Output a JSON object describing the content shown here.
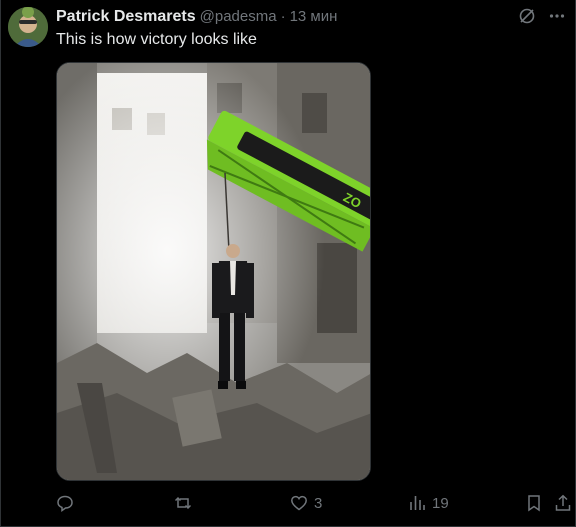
{
  "post": {
    "author_name": "Patrick Desmarets",
    "author_handle": "@padesma",
    "separator": "·",
    "time_ago": "13 мин",
    "text": "This is how victory looks like"
  },
  "media": {
    "crane_label": "ZO"
  },
  "actions": {
    "reply_count": "",
    "repost_count": "",
    "like_count": "3",
    "views_count": "19"
  },
  "icons": {
    "grok": "grok-icon",
    "more": "more-icon",
    "reply": "reply-icon",
    "repost": "repost-icon",
    "like": "like-icon",
    "views": "views-icon",
    "bookmark": "bookmark-icon",
    "share": "share-icon"
  },
  "colors": {
    "background": "#000000",
    "text_primary": "#e7e9ea",
    "text_secondary": "#71767b",
    "border": "#2f3336",
    "crane_green": "#7ed32a"
  }
}
